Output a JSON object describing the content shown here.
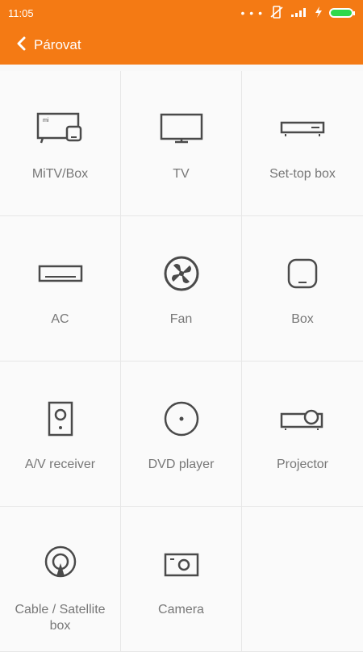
{
  "status": {
    "time": "11:05",
    "dots": "• • •"
  },
  "header": {
    "title": "Párovat"
  },
  "devices": [
    {
      "label": "MiTV/Box"
    },
    {
      "label": "TV"
    },
    {
      "label": "Set-top box"
    },
    {
      "label": "AC"
    },
    {
      "label": "Fan"
    },
    {
      "label": "Box"
    },
    {
      "label": "A/V receiver"
    },
    {
      "label": "DVD player"
    },
    {
      "label": "Projector"
    },
    {
      "label": "Cable / Satellite box"
    },
    {
      "label": "Camera"
    }
  ],
  "icons": [
    "mitv-box-icon",
    "tv-icon",
    "set-top-box-icon",
    "ac-icon",
    "fan-icon",
    "box-icon",
    "av-receiver-icon",
    "dvd-player-icon",
    "projector-icon",
    "cable-satellite-icon",
    "camera-icon"
  ],
  "colors": {
    "accent": "#f47a14",
    "battery": "#2fd94b",
    "text": "#777777"
  }
}
